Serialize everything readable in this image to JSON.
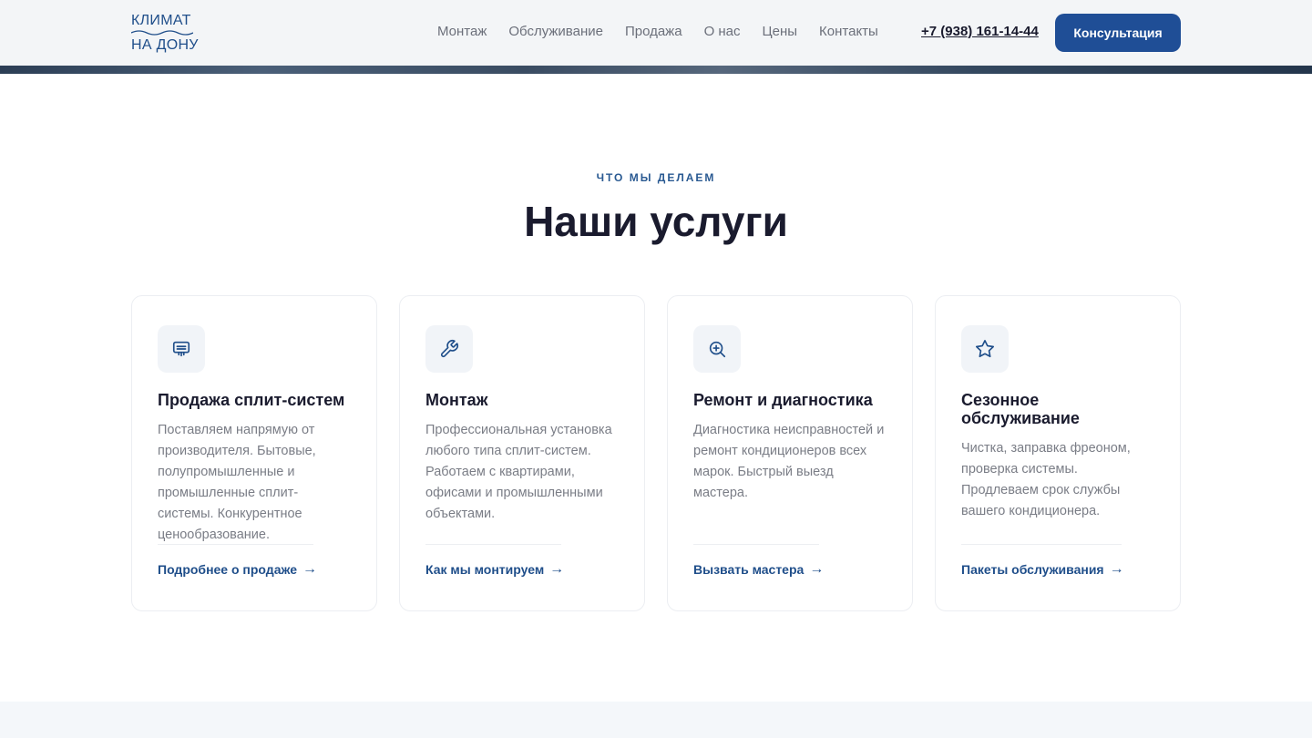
{
  "logo": {
    "line1": "КЛИМАТ",
    "line2": "НА ДОНУ"
  },
  "nav": {
    "items": [
      "Монтаж",
      "Обслуживание",
      "Продажа",
      "О нас",
      "Цены",
      "Контакты"
    ]
  },
  "header": {
    "phone": "+7 (938) 161-14-44",
    "cta_label": "Консультация"
  },
  "services": {
    "eyebrow": "ЧТО МЫ ДЕЛАЕМ",
    "title": "Наши услуги",
    "cards": [
      {
        "icon": "ac-unit-icon",
        "title": "Продажа сплит-систем",
        "description": "Поставляем напрямую от производителя. Бытовые, полупромышленные и промышленные сплит-системы. Конкурентное ценообразование.",
        "link": "Подробнее о продаже"
      },
      {
        "icon": "wrench-icon",
        "title": "Монтаж",
        "description": "Профессиональная установка любого типа сплит-систем. Работаем с квартирами, офисами и промышленными объектами.",
        "link": "Как мы монтируем"
      },
      {
        "icon": "zoom-in-icon",
        "title": "Ремонт и диагностика",
        "description": "Диагностика неисправностей и ремонт кондиционеров всех марок. Быстрый выезд мастера.",
        "link": "Вызвать мастера"
      },
      {
        "icon": "star-icon",
        "title": "Сезонное обслуживание",
        "description": "Чистка, заправка фреоном, проверка системы. Продлеваем срок службы вашего кондиционера.",
        "link": "Пакеты обслуживания"
      }
    ]
  },
  "colors": {
    "accent": "#1f4e96",
    "link": "#1f4e8a",
    "text": "#1a1b2e",
    "muted": "#7a7d86"
  }
}
